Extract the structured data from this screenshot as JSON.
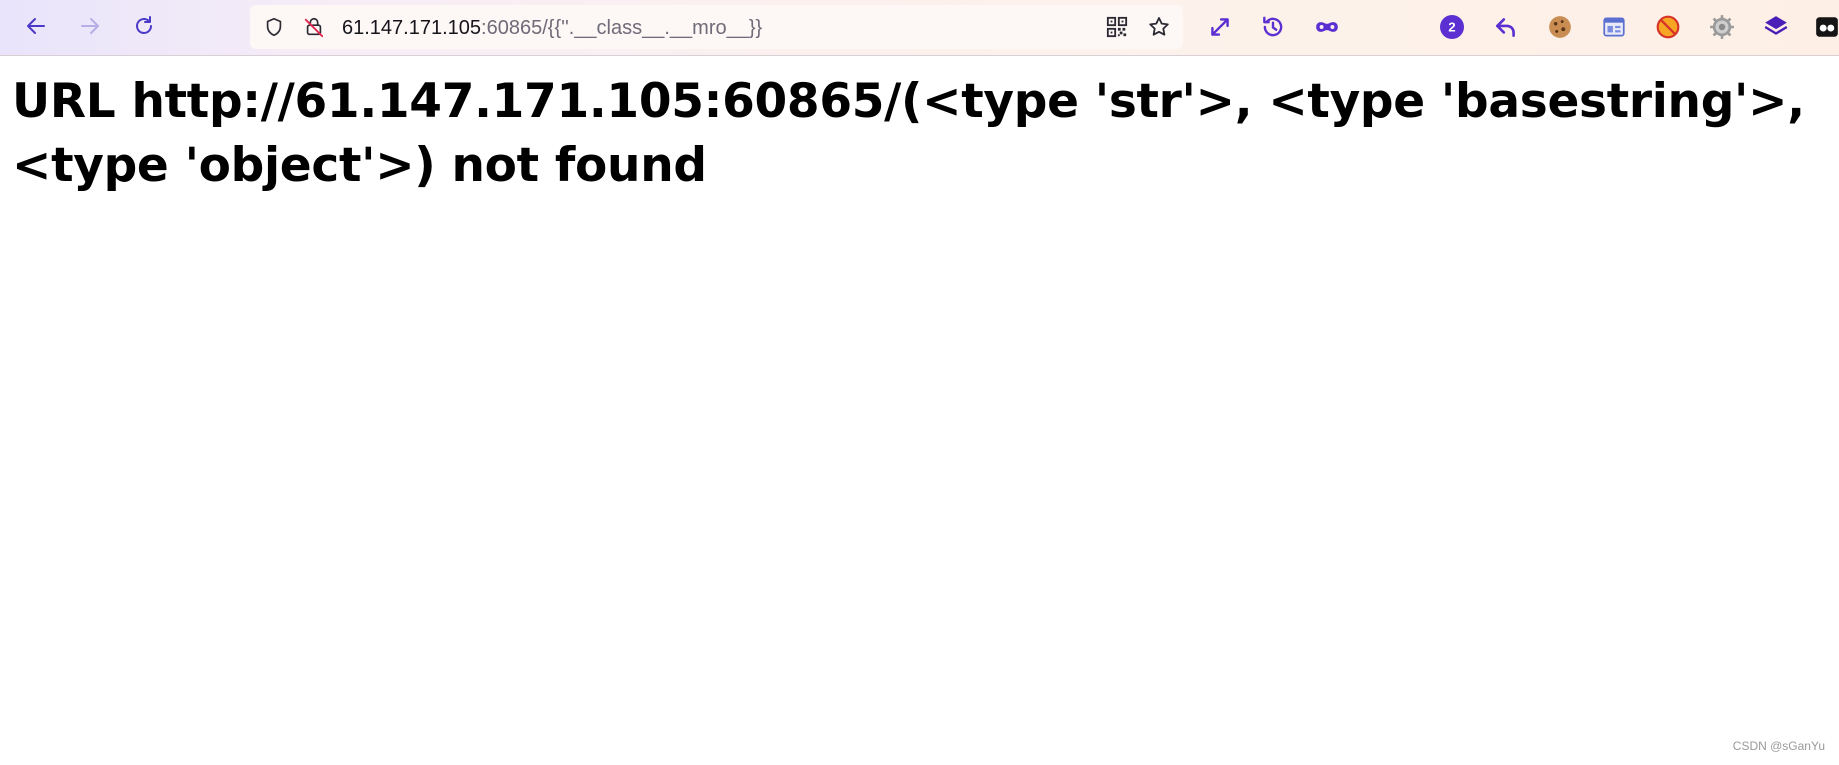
{
  "browser": {
    "address_bar": {
      "host": "61.147.171.105",
      "path": ":60865/{{''.__class__.__mro__}}"
    },
    "extension_badge_count": "2",
    "accent_color": "#5b2fd1"
  },
  "page": {
    "heading": "URL http://61.147.171.105:60865/(<type 'str'>, <type 'basestring'>, <type 'object'>) not found"
  },
  "watermark": "CSDN @sGanYu"
}
